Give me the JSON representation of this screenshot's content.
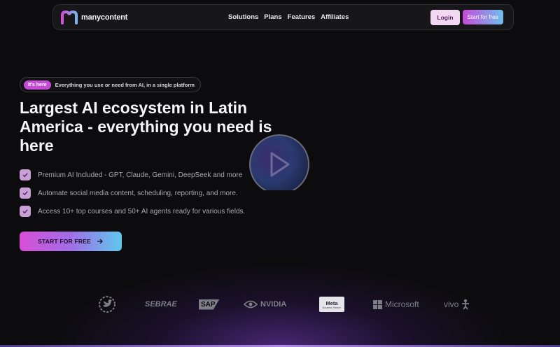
{
  "nav": {
    "brand": "manycontent",
    "links": [
      "Solutions",
      "Plans",
      "Features",
      "Affiliates"
    ],
    "login": "Login",
    "start": "Start for free"
  },
  "hero": {
    "badge_pill": "It's here",
    "badge_text": "Everything you use or need from AI, in a single platform",
    "title": "Largest AI ecosystem in Latin America - everything you need is here",
    "features": [
      "Premium AI Included - GPT, Claude, Gemini, DeepSeek and more",
      "Automate social media content, scheduling, reporting, and more.",
      "Access 10+ top courses and 50+ AI agents ready for various fields."
    ],
    "cta": "START FOR FREE"
  },
  "partners": {
    "sebrae": "SEBRAE",
    "sap": "SAP",
    "nvidia": "NVIDIA",
    "meta": "Meta",
    "meta_sub": "Business Partner",
    "microsoft": "Microsoft",
    "vivo": "vivo"
  },
  "colors": {
    "background": "#0c0c0e",
    "accent_pink": "#d84ed6",
    "accent_blue": "#5ec8ee",
    "check": "#c9a0d6"
  },
  "icons": [
    "logo-mark-icon",
    "check-icon",
    "arrow-right-icon",
    "play-icon",
    "twitter-bird-icon",
    "nvidia-eye-icon",
    "microsoft-grid-icon",
    "vivo-figure-icon"
  ]
}
